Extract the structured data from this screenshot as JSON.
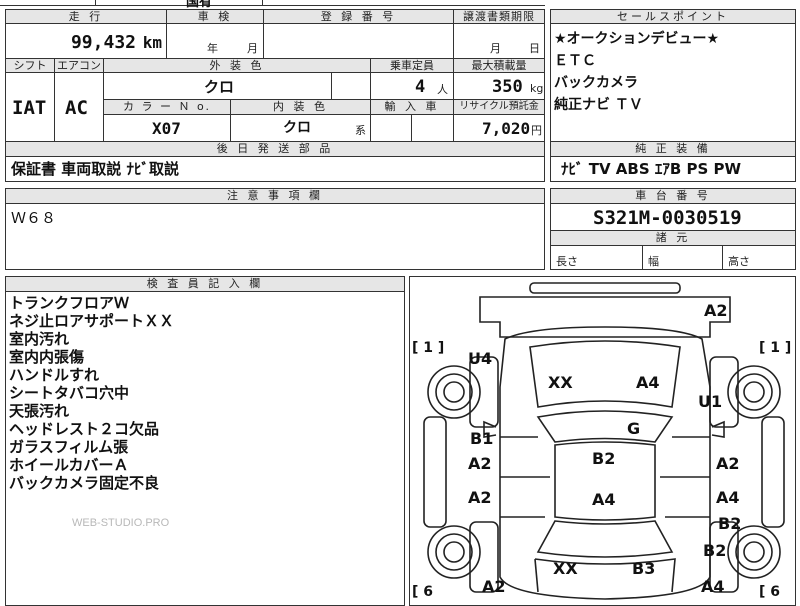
{
  "header_top": {
    "partial_label": "国有",
    "mileage_label": "走 行",
    "inspection_label": "車 検",
    "registration_label": "登 録 番 号",
    "transfer_docs_label": "譲渡書類期限",
    "sales_point_label": "セールスポイント"
  },
  "mileage": {
    "value": "99,432",
    "unit": "km"
  },
  "inspection": {
    "year_unit": "年",
    "month_unit": "月"
  },
  "transfer_docs": {
    "month_unit": "月",
    "day_unit": "日"
  },
  "sales_points": [
    "★オークションデビュー★",
    "ＥＴＣ",
    "バックカメラ",
    "純正ナビ ＴＶ"
  ],
  "row2_labels": {
    "shift": "シフト",
    "aircon": "エアコン",
    "exterior": "外 装 色",
    "capacity": "乗車定員",
    "max_load": "最大積載量"
  },
  "shift_value": "IAT",
  "aircon_value": "AC",
  "exterior_color": "クロ",
  "capacity": {
    "value": "4",
    "unit": "人"
  },
  "max_load": {
    "value": "350",
    "unit": "kg"
  },
  "row3_labels": {
    "color_no": "カ ラ ー Ｎ o.",
    "interior": "内 装 色",
    "import": "輸 入 車",
    "recycle": "リサイクル預託金"
  },
  "color_no": "X07",
  "interior_color": {
    "value": "クロ",
    "suffix": "系"
  },
  "recycle_fee": {
    "value": "7,020",
    "unit": "円"
  },
  "later_parts": {
    "label": "後 日 発 送 部 品",
    "value": "保証書 車両取説 ﾅﾋﾞ取説"
  },
  "standard_equipment": {
    "label": "純 正 装 備",
    "value": "ﾅﾋﾞ TV ABS ｴｱB PS PW"
  },
  "notes": {
    "label": "注 意 事 項 欄",
    "value": "Ｗ６８"
  },
  "chassis": {
    "label": "車 台 番 号",
    "value": "S321M-0030519"
  },
  "dimensions": {
    "label": "諸 元",
    "length": "長さ",
    "width": "幅",
    "height": "高さ"
  },
  "inspector": {
    "label": "検 査 員 記 入 欄",
    "items": [
      "トランクフロアＷ",
      "ネジ止ロアサポートＸＸ",
      "室内汚れ",
      "室内内張傷",
      "ハンドルすれ",
      "シートタバコ穴中",
      "天張汚れ",
      "ヘッドレスト２コ欠品",
      "ガラスフィルム張",
      "ホイールカバーＡ",
      "バックカメラ固定不良"
    ],
    "watermark": "WEB-STUDIO.PRO"
  },
  "diagram": {
    "bracket_left_top": "[ 1 ]",
    "bracket_right_top": "[ 1 ]",
    "bracket_left_bottom": "[ 6",
    "bracket_right_bottom": "[ 6",
    "marks": {
      "a2_top": "A2",
      "u4": "U4",
      "u1": "U1",
      "xx_front": "XX",
      "a4_front": "A4",
      "g": "G",
      "b1": "B1",
      "a2_left1": "A2",
      "b2_center": "B2",
      "a2_right1": "A2",
      "a2_left2": "A2",
      "a4_center": "A4",
      "a4_right": "A4",
      "b2_right1": "B2",
      "b2_right2": "B2",
      "xx_rear": "XX",
      "b3": "B3",
      "a2_bottom": "A2",
      "a4_bottom": "A4"
    }
  }
}
